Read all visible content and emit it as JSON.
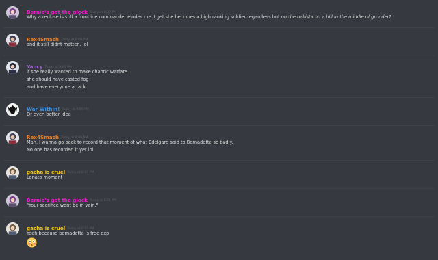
{
  "colors": {
    "background": "#36393f",
    "message_text": "#dcddde",
    "timestamp": "#5d6067",
    "pink_name": "#e91ec9",
    "orange_name": "#e67e22",
    "purple_name": "#a366d4",
    "blue_name": "#3f8ede",
    "yellow_name": "#f1c40f"
  },
  "messages": [
    {
      "author": "Bernie's got the glock",
      "timestamp": "Today at 8:00 PM",
      "avatar_icon": "pink-character-avatar-icon",
      "lines": [
        {
          "text": "Why a recluse is still a frontline commander eludes me. I get she becomes a high ranking soldier regardless but ",
          "italic": "on the ballista on a hill in the middle of gronder?"
        }
      ]
    },
    {
      "author": "Rex4Smash",
      "timestamp": "Today at 8:00 PM",
      "avatar_icon": "armored-character-avatar-icon",
      "lines": [
        {
          "text": "and it still didnt matter.. lol"
        }
      ]
    },
    {
      "author": "Yancy",
      "timestamp": "Today at 8:00 PM",
      "avatar_icon": "dark-character-avatar-icon",
      "lines": [
        {
          "text": "if she really wanted to make chaotic warfare"
        },
        {
          "text": "she should have casted fog"
        },
        {
          "text": "and have everyone attack"
        }
      ]
    },
    {
      "author": "War Within!",
      "timestamp": "Today at 8:00 PM",
      "avatar_icon": "black-crest-avatar-icon",
      "lines": [
        {
          "text": "Or even better idea"
        }
      ]
    },
    {
      "author": "Rex4Smash",
      "timestamp": "Today at 8:00 PM",
      "avatar_icon": "armored-character-avatar-icon",
      "lines": [
        {
          "text": "Man, I wanna go back to record that moment of what Edelgard said to Bernadetta so badly."
        },
        {
          "text": "No one has recorded it yet lol"
        }
      ]
    },
    {
      "author": "gacha is cruel",
      "timestamp": "Today at 8:01 PM",
      "avatar_icon": "knight-character-avatar-icon",
      "lines": [
        {
          "text": "Lonato moment"
        }
      ]
    },
    {
      "author": "Bernie's got the glock",
      "timestamp": "Today at 8:01 PM",
      "avatar_icon": "pink-character-avatar-icon",
      "lines": [
        {
          "text": "\"Your sacrifice wont be in vain.\""
        }
      ]
    },
    {
      "author": "gacha is cruel",
      "timestamp": "Today at 8:01 PM",
      "avatar_icon": "knight-character-avatar-icon",
      "lines": [
        {
          "text": "Yeah because bernadetta is free exp"
        }
      ],
      "emoji": "flushed-face-emoji-icon"
    }
  ]
}
